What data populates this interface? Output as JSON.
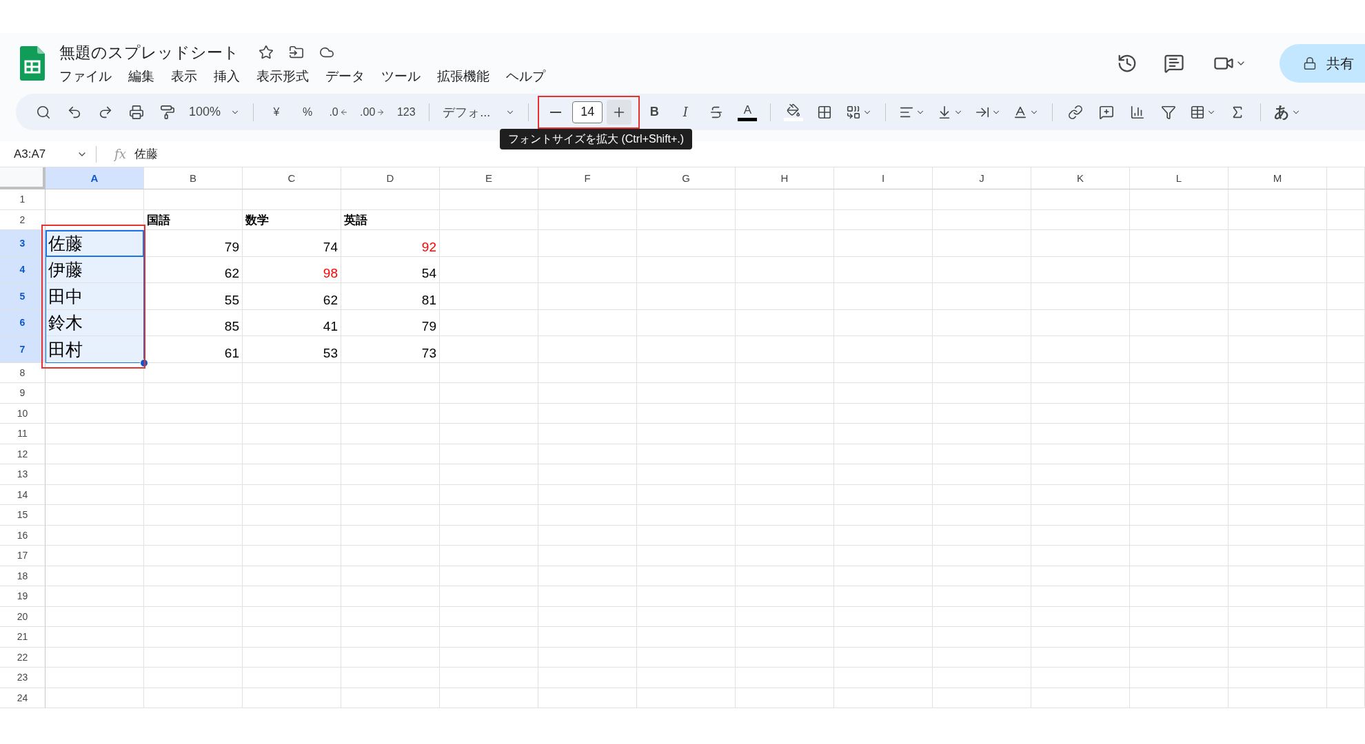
{
  "document": {
    "title": "無題のスプレッドシート"
  },
  "menu": [
    "ファイル",
    "編集",
    "表示",
    "挿入",
    "表示形式",
    "データ",
    "ツール",
    "拡張機能",
    "ヘルプ"
  ],
  "share_button": "共有",
  "toolbar": {
    "zoom": "100%",
    "currency": "¥",
    "percent": "%",
    "decrease_decimals": ".0",
    "increase_decimals": ".00",
    "number_format": "123",
    "font": "デフォ...",
    "font_size": "14",
    "increase_hovered": true,
    "bold": "B",
    "italic": "I",
    "text_color": "A",
    "input_tools": "あ"
  },
  "tooltip": "フォントサイズを拡大 (Ctrl+Shift+.)",
  "name_box": "A3:A7",
  "formula": {
    "fx": "fx",
    "value": "佐藤"
  },
  "columns": [
    {
      "label": "A",
      "selected": true
    },
    {
      "label": "B",
      "selected": false
    },
    {
      "label": "C",
      "selected": false
    },
    {
      "label": "D",
      "selected": false
    },
    {
      "label": "E",
      "selected": false
    },
    {
      "label": "F",
      "selected": false
    },
    {
      "label": "G",
      "selected": false
    },
    {
      "label": "H",
      "selected": false
    },
    {
      "label": "I",
      "selected": false
    },
    {
      "label": "J",
      "selected": false
    },
    {
      "label": "K",
      "selected": false
    },
    {
      "label": "L",
      "selected": false
    },
    {
      "label": "M",
      "selected": false
    }
  ],
  "rows": [
    {
      "label": "1",
      "selected": false,
      "cells": []
    },
    {
      "label": "2",
      "selected": false,
      "cells": [
        null,
        {
          "kind": "header",
          "text": "国語"
        },
        {
          "kind": "header",
          "text": "数学"
        },
        {
          "kind": "header",
          "text": "英語"
        }
      ]
    },
    {
      "label": "3",
      "selected": true,
      "cells": [
        {
          "kind": "name",
          "text": "佐藤"
        },
        {
          "kind": "number",
          "text": "79"
        },
        {
          "kind": "number",
          "text": "74"
        },
        {
          "kind": "number",
          "text": "92",
          "color": "#ff0000"
        }
      ]
    },
    {
      "label": "4",
      "selected": true,
      "cells": [
        {
          "kind": "name",
          "text": "伊藤"
        },
        {
          "kind": "number",
          "text": "62"
        },
        {
          "kind": "number",
          "text": "98",
          "color": "#ff0000"
        },
        {
          "kind": "number",
          "text": "54"
        }
      ]
    },
    {
      "label": "5",
      "selected": true,
      "cells": [
        {
          "kind": "name",
          "text": "田中"
        },
        {
          "kind": "number",
          "text": "55"
        },
        {
          "kind": "number",
          "text": "62"
        },
        {
          "kind": "number",
          "text": "81"
        }
      ]
    },
    {
      "label": "6",
      "selected": true,
      "cells": [
        {
          "kind": "name",
          "text": "鈴木"
        },
        {
          "kind": "number",
          "text": "85"
        },
        {
          "kind": "number",
          "text": "41"
        },
        {
          "kind": "number",
          "text": "79"
        }
      ]
    },
    {
      "label": "7",
      "selected": true,
      "cells": [
        {
          "kind": "name",
          "text": "田村"
        },
        {
          "kind": "number",
          "text": "61"
        },
        {
          "kind": "number",
          "text": "53"
        },
        {
          "kind": "number",
          "text": "73"
        }
      ]
    },
    {
      "label": "8",
      "selected": false,
      "cells": []
    },
    {
      "label": "9",
      "selected": false,
      "cells": []
    },
    {
      "label": "10",
      "selected": false,
      "cells": []
    },
    {
      "label": "11",
      "selected": false,
      "cells": []
    },
    {
      "label": "12",
      "selected": false,
      "cells": []
    },
    {
      "label": "13",
      "selected": false,
      "cells": []
    },
    {
      "label": "14",
      "selected": false,
      "cells": []
    },
    {
      "label": "15",
      "selected": false,
      "cells": []
    },
    {
      "label": "16",
      "selected": false,
      "cells": []
    },
    {
      "label": "17",
      "selected": false,
      "cells": []
    },
    {
      "label": "18",
      "selected": false,
      "cells": []
    },
    {
      "label": "19",
      "selected": false,
      "cells": []
    },
    {
      "label": "20",
      "selected": false,
      "cells": []
    },
    {
      "label": "21",
      "selected": false,
      "cells": []
    },
    {
      "label": "22",
      "selected": false,
      "cells": []
    },
    {
      "label": "23",
      "selected": false,
      "cells": []
    },
    {
      "label": "24",
      "selected": false,
      "cells": []
    }
  ]
}
